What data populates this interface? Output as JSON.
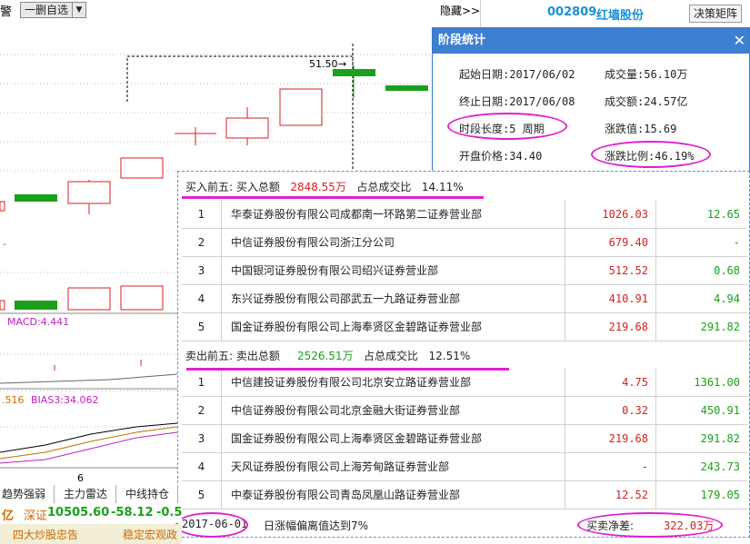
{
  "toolbar": {
    "left_label": "警",
    "watchlist_dropdown": "一删自选",
    "hide_label": "隐藏>>"
  },
  "stock": {
    "code": "002809",
    "name": "红墙股份",
    "decision_button": "决策矩阵"
  },
  "stats_window": {
    "title": "阶段统计",
    "start_date": "起始日期:2017/06/02",
    "end_date": "终止日期:2017/06/08",
    "period_length": "时段长度:5 周期",
    "open_price": "开盘价格:34.40",
    "volume": "成交量:56.10万",
    "turnover": "成交额:24.57亿",
    "change_value": "涨跌值:15.69",
    "change_pct": "涨跌比例:46.19%"
  },
  "chart": {
    "price_label": "51.50",
    "macd_label": "MACD:4.441",
    "bias_prefix": ".516",
    "bias_label": "BIAS3:34.062",
    "x_tick": "6",
    "dash_label": "-"
  },
  "buy_section": {
    "title": "买入前五: 买入总额",
    "total": "2848.55万",
    "ratio_label": "占总成交比",
    "ratio": "14.11%",
    "rows": [
      {
        "idx": "1",
        "name": "华泰证券股份有限公司成都南一环路第二证券营业部",
        "v1": "1026.03",
        "v2": "12.65"
      },
      {
        "idx": "2",
        "name": "中信证券股份有限公司浙江分公司",
        "v1": "679.40",
        "v2": "-"
      },
      {
        "idx": "3",
        "name": "中国银河证券股份有限公司绍兴证券营业部",
        "v1": "512.52",
        "v2": "0.68"
      },
      {
        "idx": "4",
        "name": "东兴证券股份有限公司邵武五一九路证券营业部",
        "v1": "410.91",
        "v2": "4.94"
      },
      {
        "idx": "5",
        "name": "国金证券股份有限公司上海奉贤区金碧路证券营业部",
        "v1": "219.68",
        "v2": "291.82"
      }
    ]
  },
  "sell_section": {
    "title": "卖出前五: 卖出总额",
    "total": "2526.51万",
    "ratio_label": "占总成交比",
    "ratio": "12.51%",
    "rows": [
      {
        "idx": "1",
        "name": "中信建投证券股份有限公司北京安立路证券营业部",
        "v1": "4.75",
        "v2": "1361.00"
      },
      {
        "idx": "2",
        "name": "中信证券股份有限公司北京金融大街证券营业部",
        "v1": "0.32",
        "v2": "450.91"
      },
      {
        "idx": "3",
        "name": "国金证券股份有限公司上海奉贤区金碧路证券营业部",
        "v1": "219.68",
        "v2": "291.82"
      },
      {
        "idx": "4",
        "name": "天风证券股份有限公司上海芳甸路证券营业部",
        "v1": "-",
        "v2": "243.73"
      },
      {
        "idx": "5",
        "name": "中泰证券股份有限公司青岛凤凰山路证券营业部",
        "v1": "12.52",
        "v2": "179.05"
      }
    ]
  },
  "footer": {
    "date": "2017-06-01",
    "description": "日涨幅偏离值达到7%",
    "net_label": "买卖净差:",
    "net_value": "322.03万"
  },
  "tabs": [
    "趋势强弱",
    "主力雷达",
    "中线持仓"
  ],
  "status": {
    "unit": "亿",
    "index_name": "深证",
    "index_value": "10505.60",
    "change": "-58.12",
    "change_pct": "-0.5"
  },
  "ticker": {
    "item1": "四大炒股忠告",
    "item2": "稳定宏观政"
  },
  "colors": {
    "up": "#d62020",
    "down": "#1aa01a",
    "accent": "#3d7fd1",
    "highlight": "#e020d0"
  }
}
